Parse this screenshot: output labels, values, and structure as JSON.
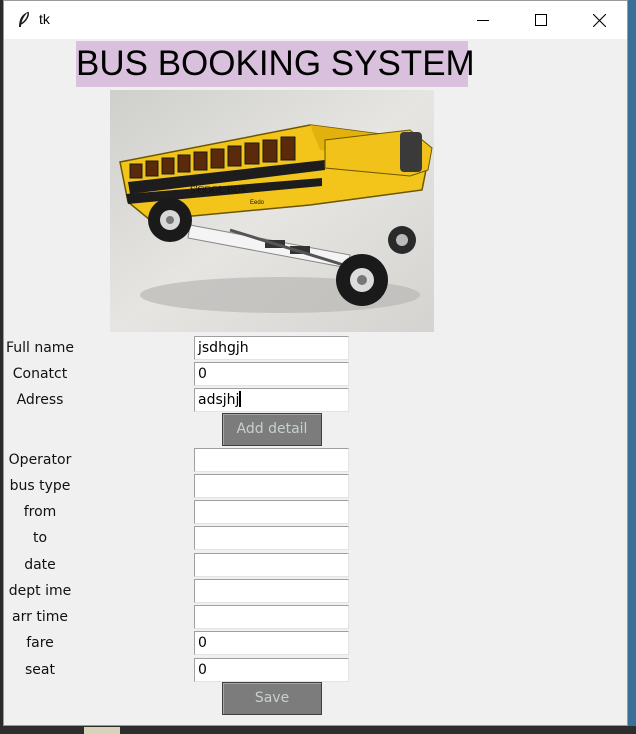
{
  "window": {
    "title": "tk"
  },
  "app": {
    "heading": "BUS BOOKING SYSTEM",
    "heading_bg": "#d9c1dd",
    "image_caption": "S'COOL BUS",
    "image_brand": "Eedo"
  },
  "customer": {
    "full_name_label": "Full name",
    "full_name_value": "jsdhgjh",
    "contact_label": "Conatct",
    "contact_value": "0",
    "address_label": "Adress",
    "address_value": "adsjhj",
    "add_button": "Add detail"
  },
  "booking": {
    "operator_label": "Operator",
    "operator_value": "",
    "bus_type_label": "bus type",
    "bus_type_value": "",
    "from_label": "from",
    "from_value": "",
    "to_label": "to",
    "to_value": "",
    "date_label": "date",
    "date_value": "",
    "dept_time_label": "dept ime",
    "dept_time_value": "",
    "arr_time_label": "arr time",
    "arr_time_value": "",
    "fare_label": "fare",
    "fare_value": "0",
    "seat_label": "seat",
    "seat_value": "0",
    "save_button": "Save"
  },
  "icons": {
    "app_icon": "feather-icon",
    "minimize": "minimize-icon",
    "maximize": "maximize-icon",
    "close": "close-icon"
  },
  "colors": {
    "button_bg": "#7c7c7c",
    "button_text": "#c8cfcf",
    "window_bg": "#f0f0f0"
  }
}
